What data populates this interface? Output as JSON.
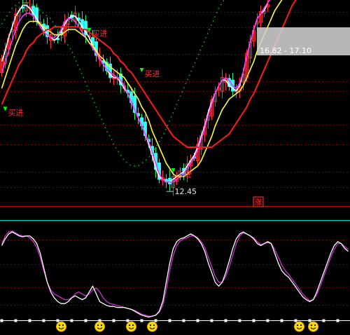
{
  "chart_data": [
    {
      "type": "candlestick",
      "panel": "price",
      "title": "",
      "xlabel": "",
      "ylabel": "",
      "n_bars": 100,
      "price_range": [
        11.8,
        19.5
      ],
      "min_label": "12.45",
      "min_value": 12.45,
      "min_bar_index": 47,
      "tooltip_text": "16.82 - 17.10",
      "badge_text": "涨",
      "buy_signal_text": "买进",
      "buy_signals": [
        {
          "bar": 1,
          "price": 15.3
        },
        {
          "bar": 25,
          "price": 18.25
        },
        {
          "bar": 40,
          "price": 16.75
        },
        {
          "bar": 49,
          "price": 13.0
        }
      ],
      "series": [
        {
          "name": "",
          "color": "#ffffff",
          "values": [
            17.2,
            17.6,
            18.1,
            18.5,
            18.9,
            19.1,
            19.3,
            19.3,
            19.2,
            19.0,
            18.8,
            18.6,
            18.4,
            18.2,
            18.1,
            18.0,
            18.1,
            18.3,
            18.6,
            18.8,
            18.9,
            18.9,
            18.7,
            18.5,
            18.3,
            18.1,
            17.8,
            17.5,
            17.3,
            17.1,
            16.9,
            16.7,
            16.6,
            16.6,
            16.4,
            16.2,
            16.0,
            15.7,
            15.4,
            15.1,
            14.8,
            14.5,
            14.1,
            13.7,
            13.2,
            12.9,
            12.8,
            12.7,
            12.7,
            12.8,
            12.9,
            13.0,
            13.1,
            13.3,
            13.5,
            13.7,
            14.0,
            14.4,
            14.8,
            15.3,
            15.7,
            16.0,
            16.3,
            16.5,
            16.5,
            16.3,
            16.2,
            16.1,
            16.3,
            16.8,
            17.4,
            17.9,
            18.4,
            18.8,
            19.0,
            19.1,
            19.4,
            19.6,
            19.7,
            19.8,
            19.9,
            20.0,
            20.0,
            20.0,
            20.0,
            20.0,
            20.0,
            20.0,
            20.0,
            20.0,
            20.0,
            20.0,
            20.0,
            20.0,
            20.0,
            20.0,
            20.0,
            20.0,
            20.0,
            20.0
          ]
        },
        {
          "name": "",
          "color": "#ff33ff",
          "values": [
            16.8,
            17.2,
            17.6,
            18.0,
            18.4,
            18.7,
            18.9,
            19.0,
            19.0,
            18.9,
            18.7,
            18.5,
            18.3,
            18.2,
            18.1,
            18.1,
            18.2,
            18.4,
            18.7,
            18.8,
            18.8,
            18.7,
            18.5,
            18.3,
            18.1,
            17.9,
            17.7,
            17.5,
            17.3,
            17.1,
            16.9,
            16.8,
            16.7,
            16.6,
            16.5,
            16.3,
            16.0,
            15.7,
            15.4,
            15.1,
            14.8,
            14.5,
            14.2,
            13.8,
            13.4,
            13.0,
            12.8,
            12.7,
            12.7,
            12.7,
            12.8,
            12.9,
            13.0,
            13.2,
            13.4,
            13.6,
            13.9,
            14.3,
            14.7,
            15.2,
            15.6,
            16.0,
            16.3,
            16.5,
            16.6,
            16.5,
            16.3,
            16.2,
            16.4,
            16.8,
            17.4,
            17.9,
            18.4,
            18.8,
            19.0,
            19.2,
            19.4,
            19.6,
            19.8,
            19.9,
            20.0,
            20.0,
            20.0,
            20.0,
            20.0,
            20.0,
            20.0,
            20.0,
            20.0,
            20.0,
            20.0,
            20.0,
            20.0,
            20.0,
            20.0,
            20.0,
            20.0,
            20.0,
            20.0,
            20.0
          ]
        },
        {
          "name": "",
          "color": "#ffff33",
          "values": [
            16.2,
            16.6,
            17.0,
            17.4,
            17.8,
            18.1,
            18.4,
            18.6,
            18.7,
            18.7,
            18.7,
            18.6,
            18.5,
            18.4,
            18.3,
            18.2,
            18.2,
            18.2,
            18.3,
            18.4,
            18.4,
            18.4,
            18.3,
            18.2,
            18.1,
            17.9,
            17.8,
            17.6,
            17.4,
            17.3,
            17.1,
            17.0,
            16.9,
            16.8,
            16.7,
            16.6,
            16.4,
            16.2,
            16.0,
            15.8,
            15.5,
            15.3,
            15.0,
            14.6,
            14.3,
            14.0,
            13.7,
            13.4,
            13.2,
            13.0,
            12.9,
            12.9,
            12.9,
            13.0,
            13.1,
            13.2,
            13.3,
            13.5,
            13.8,
            14.1,
            14.4,
            14.8,
            15.1,
            15.4,
            15.6,
            15.8,
            15.9,
            16.0,
            16.1,
            16.3,
            16.6,
            16.9,
            17.2,
            17.6,
            17.9,
            18.2,
            18.5,
            18.8,
            19.1,
            19.3,
            19.5,
            19.7,
            19.9,
            20.0,
            20.0,
            20.0,
            20.0,
            20.0,
            20.0,
            20.0,
            20.0,
            20.0,
            20.0,
            20.0,
            20.0,
            20.0,
            20.0,
            20.0,
            20.0,
            20.0
          ]
        },
        {
          "name": "",
          "color": "#ff1a1a",
          "values": [
            15.6,
            15.9,
            16.2,
            16.5,
            16.8,
            17.1,
            17.3,
            17.6,
            17.8,
            17.9,
            18.1,
            18.2,
            18.3,
            18.4,
            18.4,
            18.5,
            18.5,
            18.5,
            18.5,
            18.5,
            18.5,
            18.5,
            18.5,
            18.4,
            18.4,
            18.3,
            18.2,
            18.1,
            18.0,
            17.9,
            17.8,
            17.7,
            17.5,
            17.4,
            17.2,
            17.1,
            16.9,
            16.8,
            16.6,
            16.4,
            16.2,
            16.0,
            15.8,
            15.6,
            15.4,
            15.2,
            15.0,
            14.8,
            14.6,
            14.4,
            14.3,
            14.2,
            14.1,
            14.0,
            14.0,
            14.0,
            14.0,
            14.0,
            14.0,
            14.0,
            14.0,
            14.1,
            14.2,
            14.3,
            14.4,
            14.5,
            14.7,
            14.9,
            15.1,
            15.3,
            15.5,
            15.8,
            16.0,
            16.3,
            16.6,
            16.9,
            17.2,
            17.5,
            17.8,
            18.1,
            18.4,
            18.7,
            19.0,
            19.3,
            19.5,
            19.8,
            20.0,
            20.0,
            20.0,
            20.0,
            20.0,
            20.0,
            20.0,
            20.0,
            20.0,
            20.0,
            20.0,
            20.0,
            20.0,
            20.0
          ]
        },
        {
          "name": "",
          "color": "#00cc00",
          "dotted": true,
          "values": [
            18.6,
            18.8,
            19.0,
            19.2,
            19.3,
            19.4,
            19.4,
            19.4,
            19.4,
            19.3,
            19.2,
            19.1,
            19.0,
            18.9,
            18.8,
            18.6,
            18.4,
            18.2,
            18.0,
            17.8,
            17.6,
            17.3,
            17.0,
            16.7,
            16.4,
            16.1,
            15.8,
            15.5,
            15.2,
            14.9,
            14.6,
            14.4,
            14.1,
            13.9,
            13.7,
            13.5,
            13.4,
            13.3,
            13.3,
            13.3,
            13.4,
            13.5,
            13.6,
            13.8,
            14.0,
            14.2,
            14.4,
            14.7,
            15.0,
            15.3,
            15.6,
            15.9,
            16.2,
            16.5,
            16.8,
            17.1,
            17.4,
            17.7,
            18.0,
            18.3,
            18.6,
            18.9,
            19.2,
            19.4,
            19.6,
            19.8,
            19.9,
            20.0,
            20.0,
            20.0,
            20.0,
            20.0,
            20.0,
            20.0,
            20.0,
            20.0,
            20.0,
            20.0,
            20.0,
            20.0,
            20.0,
            20.0,
            20.0,
            20.0,
            20.0,
            20.0,
            20.0,
            20.0,
            20.0,
            20.0,
            20.0,
            20.0,
            20.0,
            20.0,
            20.0,
            20.0,
            20.0,
            20.0,
            20.0,
            20.0
          ]
        }
      ]
    },
    {
      "type": "line",
      "panel": "oscillator",
      "title": "",
      "xlabel": "",
      "ylabel": "",
      "ylim": [
        0,
        100
      ],
      "series": [
        {
          "name": "",
          "color": "#ffffff",
          "values": [
            78,
            85,
            90,
            92,
            90,
            88,
            87,
            88,
            88,
            85,
            80,
            70,
            55,
            40,
            30,
            24,
            20,
            18,
            18,
            20,
            24,
            26,
            24,
            22,
            24,
            30,
            36,
            28,
            20,
            18,
            16,
            15,
            15,
            14,
            14,
            14,
            13,
            12,
            10,
            8,
            6,
            5,
            4,
            5,
            6,
            10,
            20,
            40,
            60,
            75,
            82,
            85,
            86,
            88,
            90,
            88,
            85,
            80,
            72,
            60,
            50,
            40,
            36,
            40,
            50,
            62,
            75,
            85,
            90,
            92,
            90,
            88,
            85,
            80,
            78,
            80,
            82,
            80,
            70,
            60,
            52,
            48,
            45,
            40,
            35,
            30,
            25,
            22,
            20,
            22,
            30,
            40,
            50,
            60,
            70,
            78,
            82,
            80,
            75,
            72
          ]
        },
        {
          "name": "",
          "color": "#cc33cc",
          "values": [
            80,
            88,
            92,
            93,
            91,
            89,
            88,
            88,
            86,
            82,
            76,
            66,
            52,
            40,
            32,
            28,
            26,
            24,
            22,
            22,
            24,
            28,
            30,
            28,
            26,
            28,
            32,
            34,
            30,
            24,
            20,
            18,
            17,
            16,
            15,
            14,
            13,
            12,
            11,
            9,
            7,
            6,
            5,
            5,
            6,
            9,
            16,
            32,
            52,
            68,
            78,
            83,
            85,
            86,
            88,
            88,
            86,
            82,
            76,
            66,
            56,
            46,
            40,
            40,
            46,
            56,
            68,
            80,
            88,
            91,
            90,
            88,
            86,
            82,
            79,
            80,
            81,
            80,
            74,
            66,
            58,
            52,
            48,
            43,
            38,
            33,
            28,
            24,
            21,
            22,
            27,
            36,
            46,
            56,
            66,
            74,
            80,
            80,
            77,
            74
          ]
        }
      ],
      "marker_bars": [
        17,
        28,
        37,
        43,
        85,
        89
      ]
    }
  ]
}
